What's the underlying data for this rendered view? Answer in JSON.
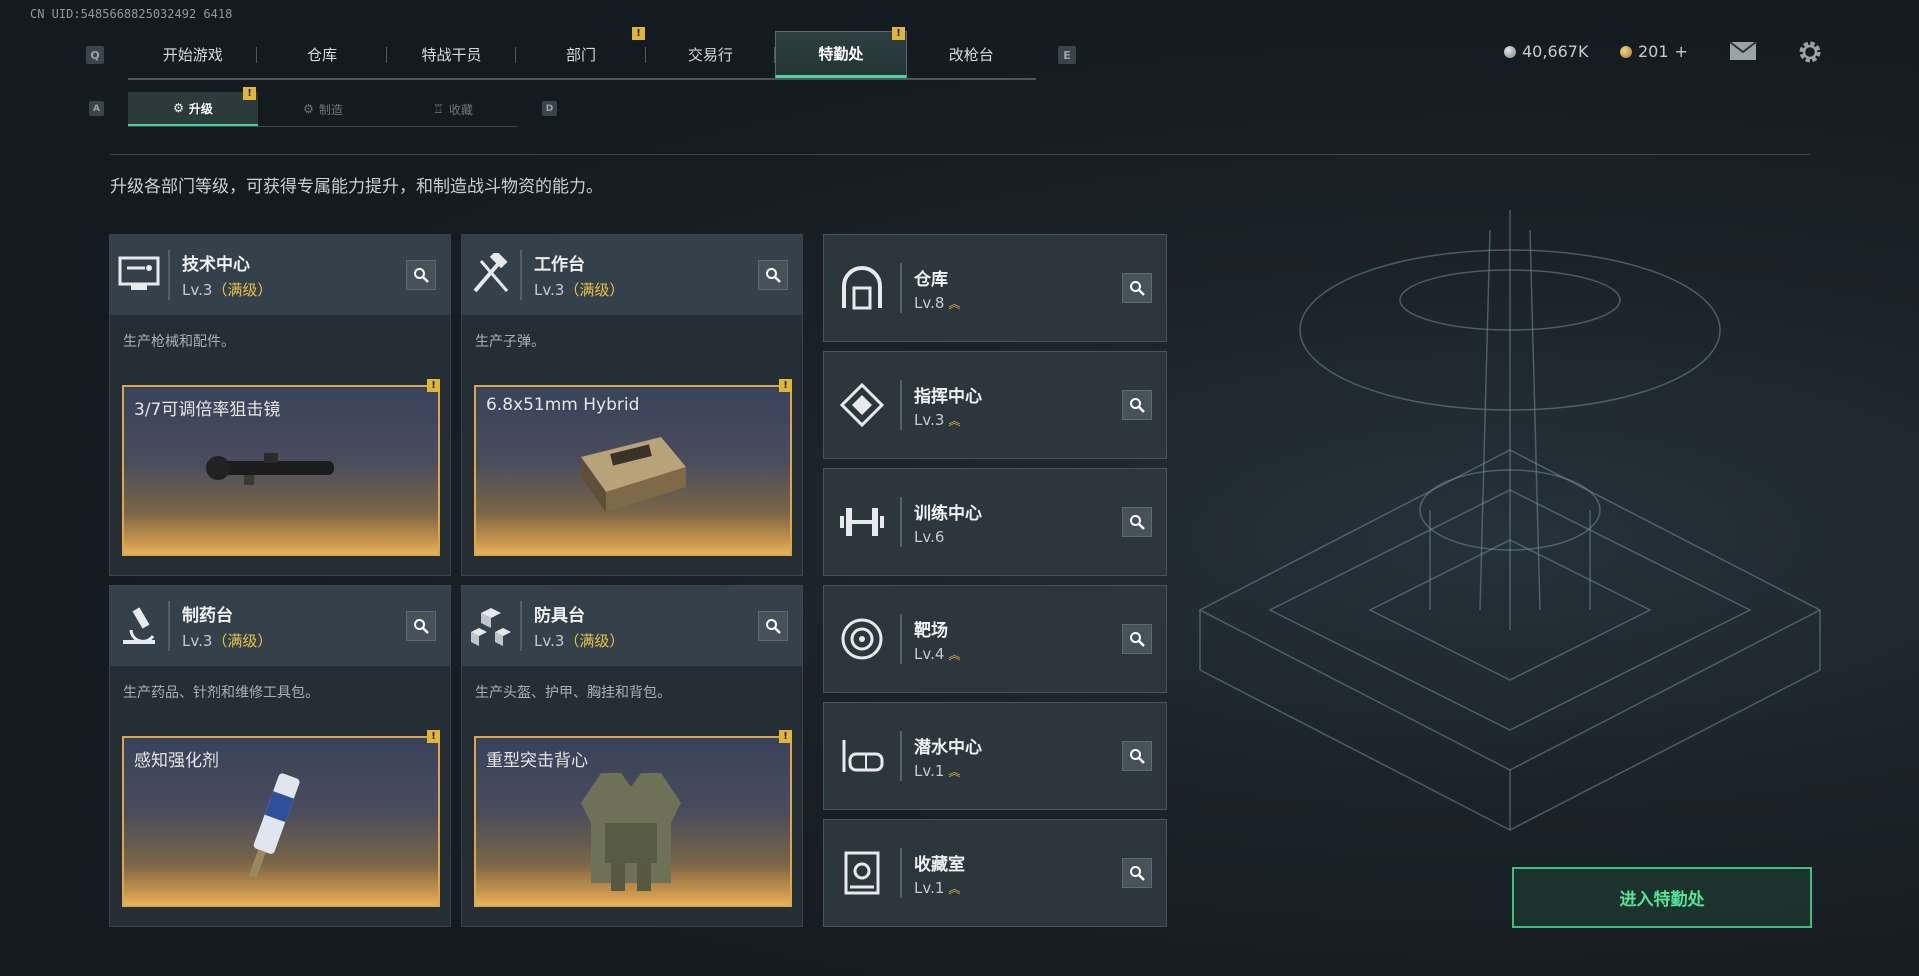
{
  "uid": "CN UID:5485668825032492 6418",
  "nav": {
    "left_key": "Q",
    "right_key": "E",
    "tabs": [
      "开始游戏",
      "仓库",
      "特战干员",
      "部门",
      "交易行",
      "特勤处",
      "改枪台"
    ],
    "active": "特勤处",
    "alert_mark": "!"
  },
  "currency": {
    "silver": "40,667K",
    "gold": "201",
    "plus": "+"
  },
  "subnav": {
    "left_key": "A",
    "right_key": "D",
    "tabs": [
      "升级",
      "制造",
      "收藏"
    ],
    "active": "升级"
  },
  "description": "升级各部门等级，可获得专属能力提升，和制造战斗物资的能力。",
  "departments": [
    {
      "name": "技术中心",
      "level": "Lv.3",
      "status": "（满级）",
      "desc": "生产枪械和配件。",
      "product": "3/7可调倍率狙击镜",
      "icon": "computer-icon"
    },
    {
      "name": "工作台",
      "level": "Lv.3",
      "status": "（满级）",
      "desc": "生产子弹。",
      "product": "6.8x51mm Hybrid",
      "icon": "tools-icon"
    },
    {
      "name": "制药台",
      "level": "Lv.3",
      "status": "（满级）",
      "desc": "生产药品、针剂和维修工具包。",
      "product": "感知强化剂",
      "icon": "microscope-icon"
    },
    {
      "name": "防具台",
      "level": "Lv.3",
      "status": "（满级）",
      "desc": "生产头盔、护甲、胸挂和背包。",
      "product": "重型突击背心",
      "icon": "cubes-icon"
    }
  ],
  "facilities": [
    {
      "name": "仓库",
      "level": "Lv.8",
      "upgradeable": true,
      "icon": "warehouse-icon"
    },
    {
      "name": "指挥中心",
      "level": "Lv.3",
      "upgradeable": true,
      "icon": "command-icon"
    },
    {
      "name": "训练中心",
      "level": "Lv.6",
      "upgradeable": false,
      "icon": "dumbbell-icon"
    },
    {
      "name": "靶场",
      "level": "Lv.4",
      "upgradeable": true,
      "icon": "target-icon"
    },
    {
      "name": "潜水中心",
      "level": "Lv.1",
      "upgradeable": true,
      "icon": "diving-mask-icon"
    },
    {
      "name": "收藏室",
      "level": "Lv.1",
      "upgradeable": true,
      "icon": "collection-icon"
    }
  ],
  "enter_button": "进入特勤处",
  "colors": {
    "accent_green": "#4ed39a",
    "gold": "#e9bf4a",
    "panel": "#35414a"
  }
}
